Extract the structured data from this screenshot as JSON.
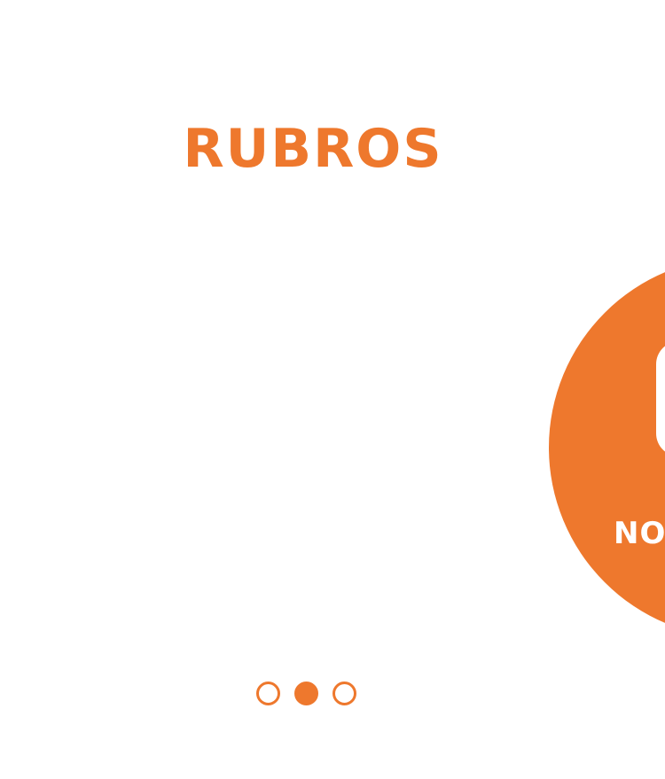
{
  "section": {
    "title": "RUBROS"
  },
  "carousel": {
    "visible_slide_label": "NO",
    "active_index": 1,
    "dots_count": 3
  },
  "colors": {
    "accent": "#EE782D",
    "background": "#FFFFFF"
  },
  "icons": {
    "slide_icon": "rounded-rectangle-icon"
  }
}
